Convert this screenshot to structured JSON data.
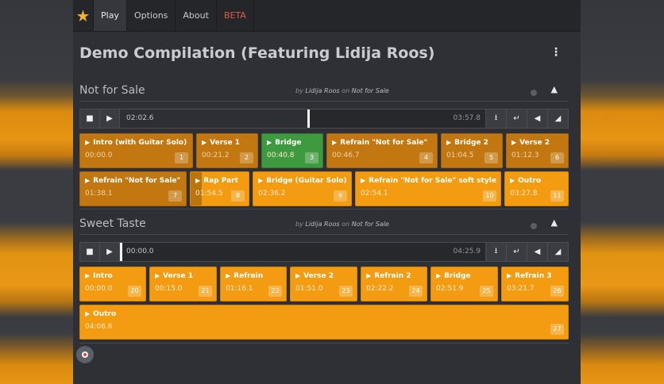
{
  "nav": {
    "logo_icon": "star-icon",
    "tabs": [
      {
        "label": "Play",
        "active": true
      },
      {
        "label": "Options",
        "active": false
      },
      {
        "label": "About",
        "active": false
      },
      {
        "label": "BETA",
        "active": false
      }
    ]
  },
  "page": {
    "title": "Demo Compilation (Featuring Lidija Roos)",
    "menu_icon": "more-vertical-icon"
  },
  "tracks": [
    {
      "title": "Not for Sale",
      "by_prefix": "by",
      "artist": "Lidija Roos",
      "on": "on",
      "album": "Not for Sale",
      "current_time": "02:02.6",
      "duration": "03:57.8",
      "progress": 0.515,
      "cues": [
        {
          "name": "Intro (with Guitar Solo)",
          "time": "00:00.0",
          "num": "1"
        },
        {
          "name": "Verse 1",
          "time": "00:21.2",
          "num": "2"
        },
        {
          "name": "Bridge",
          "time": "00:40.8",
          "num": "3"
        },
        {
          "name": "Refrain \"Not for Sale\"",
          "time": "00:46.7",
          "num": "4"
        },
        {
          "name": "Bridge 2",
          "time": "01:04.5",
          "num": "5"
        },
        {
          "name": "Verse 2",
          "time": "01:12.3",
          "num": "6"
        },
        {
          "name": "Refrain \"Not for Sale\"",
          "time": "01:38.1",
          "num": "7"
        },
        {
          "name": "Rap Part",
          "time": "01:54.5",
          "num": "8"
        },
        {
          "name": "Bridge (Guitar Solo)",
          "time": "02:36.2",
          "num": "9"
        },
        {
          "name": "Refrain \"Not for Sale\" soft style",
          "time": "02:54.1",
          "num": "10"
        },
        {
          "name": "Outro",
          "time": "03:27.8",
          "num": "11"
        }
      ]
    },
    {
      "title": "Sweet Taste",
      "by_prefix": "by",
      "artist": "Lidija Roos",
      "on": "on",
      "album": "Not for Sale",
      "current_time": "00:00.0",
      "duration": "04:25.9",
      "progress": 0,
      "cues": [
        {
          "name": "Intro",
          "time": "00:00.0",
          "num": "20"
        },
        {
          "name": "Verse 1",
          "time": "00:15.0",
          "num": "21"
        },
        {
          "name": "Refrain",
          "time": "01:16.1",
          "num": "22"
        },
        {
          "name": "Verse 2",
          "time": "01:51.0",
          "num": "23"
        },
        {
          "name": "Refrain 2",
          "time": "02:22.2",
          "num": "24"
        },
        {
          "name": "Bridge",
          "time": "02:51.9",
          "num": "25"
        },
        {
          "name": "Refrain 3",
          "time": "03:21.7",
          "num": "26"
        },
        {
          "name": "Outro",
          "time": "04:06.6",
          "num": "27"
        }
      ]
    }
  ]
}
